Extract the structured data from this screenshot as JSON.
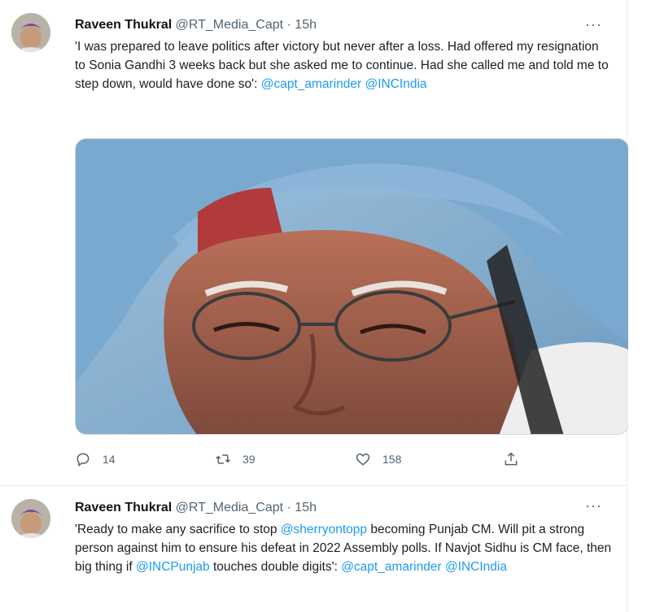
{
  "tweets": [
    {
      "author_name": "Raveen Thukral",
      "handle": "@RT_Media_Capt",
      "separator": "·",
      "time": "15h",
      "more_icon": "more-horizontal-icon",
      "text_parts": [
        "'I was prepared to leave politics after victory but never after a loss. Had offered my resignation to Sonia Gandhi 3 weeks back but she asked me to continue. Had she called me and told me to step down, would have done so': ",
        "@capt_amarinder",
        " ",
        "@INCIndia"
      ],
      "actions": {
        "replies": "14",
        "retweets": "39",
        "likes": "158"
      }
    },
    {
      "author_name": "Raveen Thukral",
      "handle": "@RT_Media_Capt",
      "separator": "·",
      "time": "15h",
      "more_icon": "more-horizontal-icon",
      "text_parts": [
        "'Ready to make any sacrifice to stop ",
        "@sherryontopp",
        " becoming Punjab CM. Will pit a strong person against him to ensure his defeat in 2022 Assembly polls. If Navjot Sidhu is CM face, then big thing if ",
        "@INCPunjab",
        " touches double digits': ",
        "@capt_amarinder",
        " ",
        "@INCIndia"
      ]
    }
  ],
  "colors": {
    "link": "#1d9bf0",
    "secondary_text": "#536471",
    "divider": "#e6ecf0"
  }
}
